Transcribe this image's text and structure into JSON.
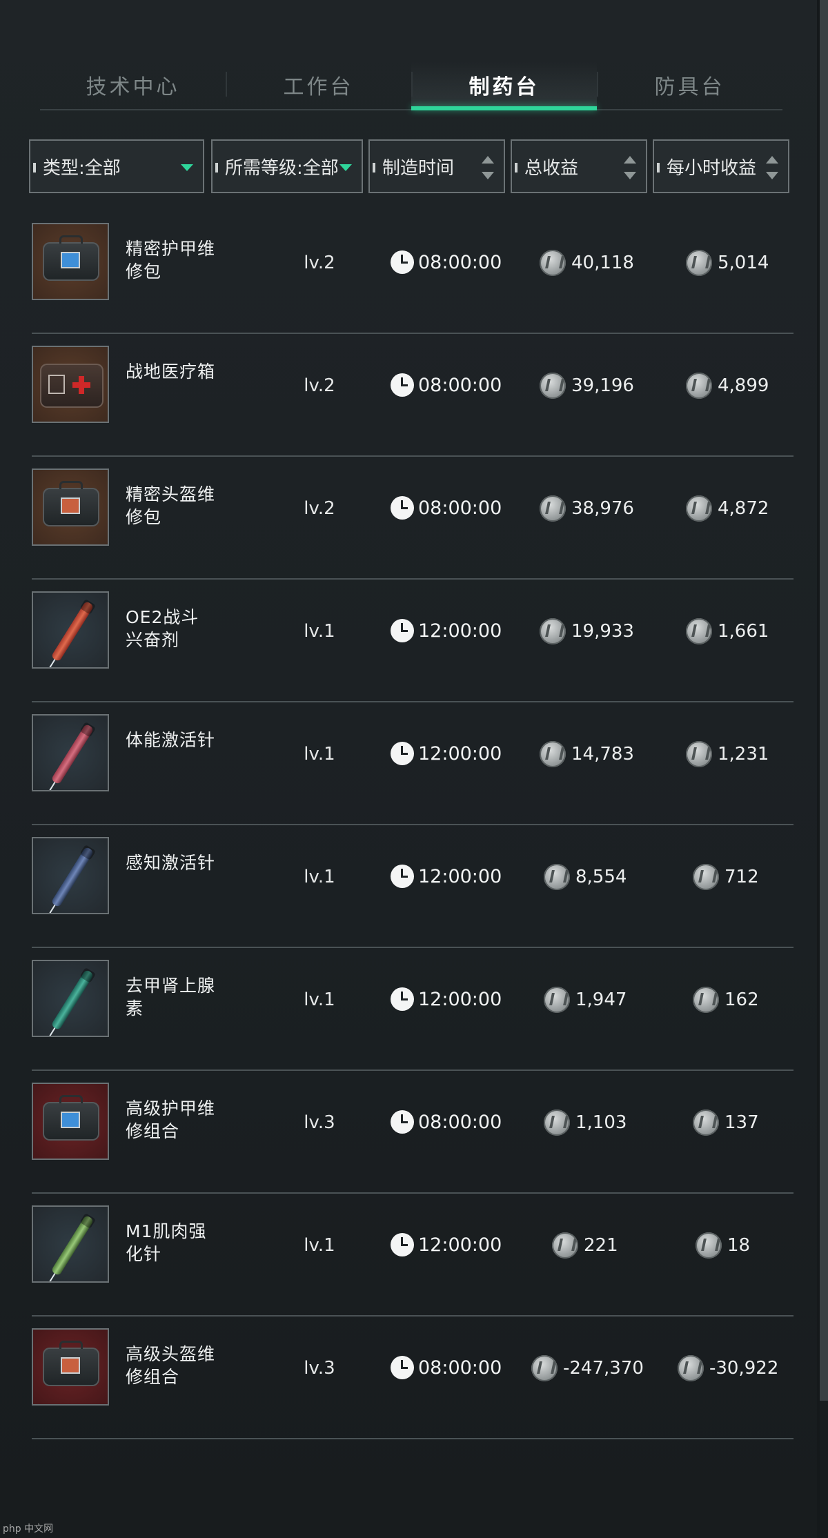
{
  "tabs": [
    {
      "label": "技术中心",
      "active": false
    },
    {
      "label": "工作台",
      "active": false
    },
    {
      "label": "制药台",
      "active": true
    },
    {
      "label": "防具台",
      "active": false
    }
  ],
  "filters": {
    "type": "类型:全部",
    "level": "所需等级:全部",
    "time": "制造时间",
    "total": "总收益",
    "hourly": "每小时收益"
  },
  "items": [
    {
      "name": "精密护甲维修包",
      "level": "lv.2",
      "time": "08:00:00",
      "total": "40,118",
      "hourly": "5,014",
      "icon": "armor-repair-kit-icon"
    },
    {
      "name": "战地医疗箱",
      "level": "lv.2",
      "time": "08:00:00",
      "total": "39,196",
      "hourly": "4,899",
      "icon": "medkit-icon"
    },
    {
      "name": "精密头盔维修包",
      "level": "lv.2",
      "time": "08:00:00",
      "total": "38,976",
      "hourly": "4,872",
      "icon": "helmet-repair-kit-icon"
    },
    {
      "name": "OE2战斗兴奋剂",
      "level": "lv.1",
      "time": "12:00:00",
      "total": "19,933",
      "hourly": "1,661",
      "icon": "syringe-icon"
    },
    {
      "name": "体能激活针",
      "level": "lv.1",
      "time": "12:00:00",
      "total": "14,783",
      "hourly": "1,231",
      "icon": "syringe-icon"
    },
    {
      "name": "感知激活针",
      "level": "lv.1",
      "time": "12:00:00",
      "total": "8,554",
      "hourly": "712",
      "icon": "syringe-icon"
    },
    {
      "name": "去甲肾上腺素",
      "level": "lv.1",
      "time": "12:00:00",
      "total": "1,947",
      "hourly": "162",
      "icon": "syringe-icon"
    },
    {
      "name": "高级护甲维修组合",
      "level": "lv.3",
      "time": "08:00:00",
      "total": "1,103",
      "hourly": "137",
      "icon": "armor-repair-combo-icon"
    },
    {
      "name": "M1肌肉强化针",
      "level": "lv.1",
      "time": "12:00:00",
      "total": "221",
      "hourly": "18",
      "icon": "syringe-icon"
    },
    {
      "name": "高级头盔维修组合",
      "level": "lv.3",
      "time": "08:00:00",
      "total": "-247,370",
      "hourly": "-30,922",
      "icon": "helmet-repair-combo-icon"
    }
  ],
  "colors": {
    "accent": "#2fd59a",
    "background": "#1d2225"
  },
  "watermark": "php 中文网"
}
